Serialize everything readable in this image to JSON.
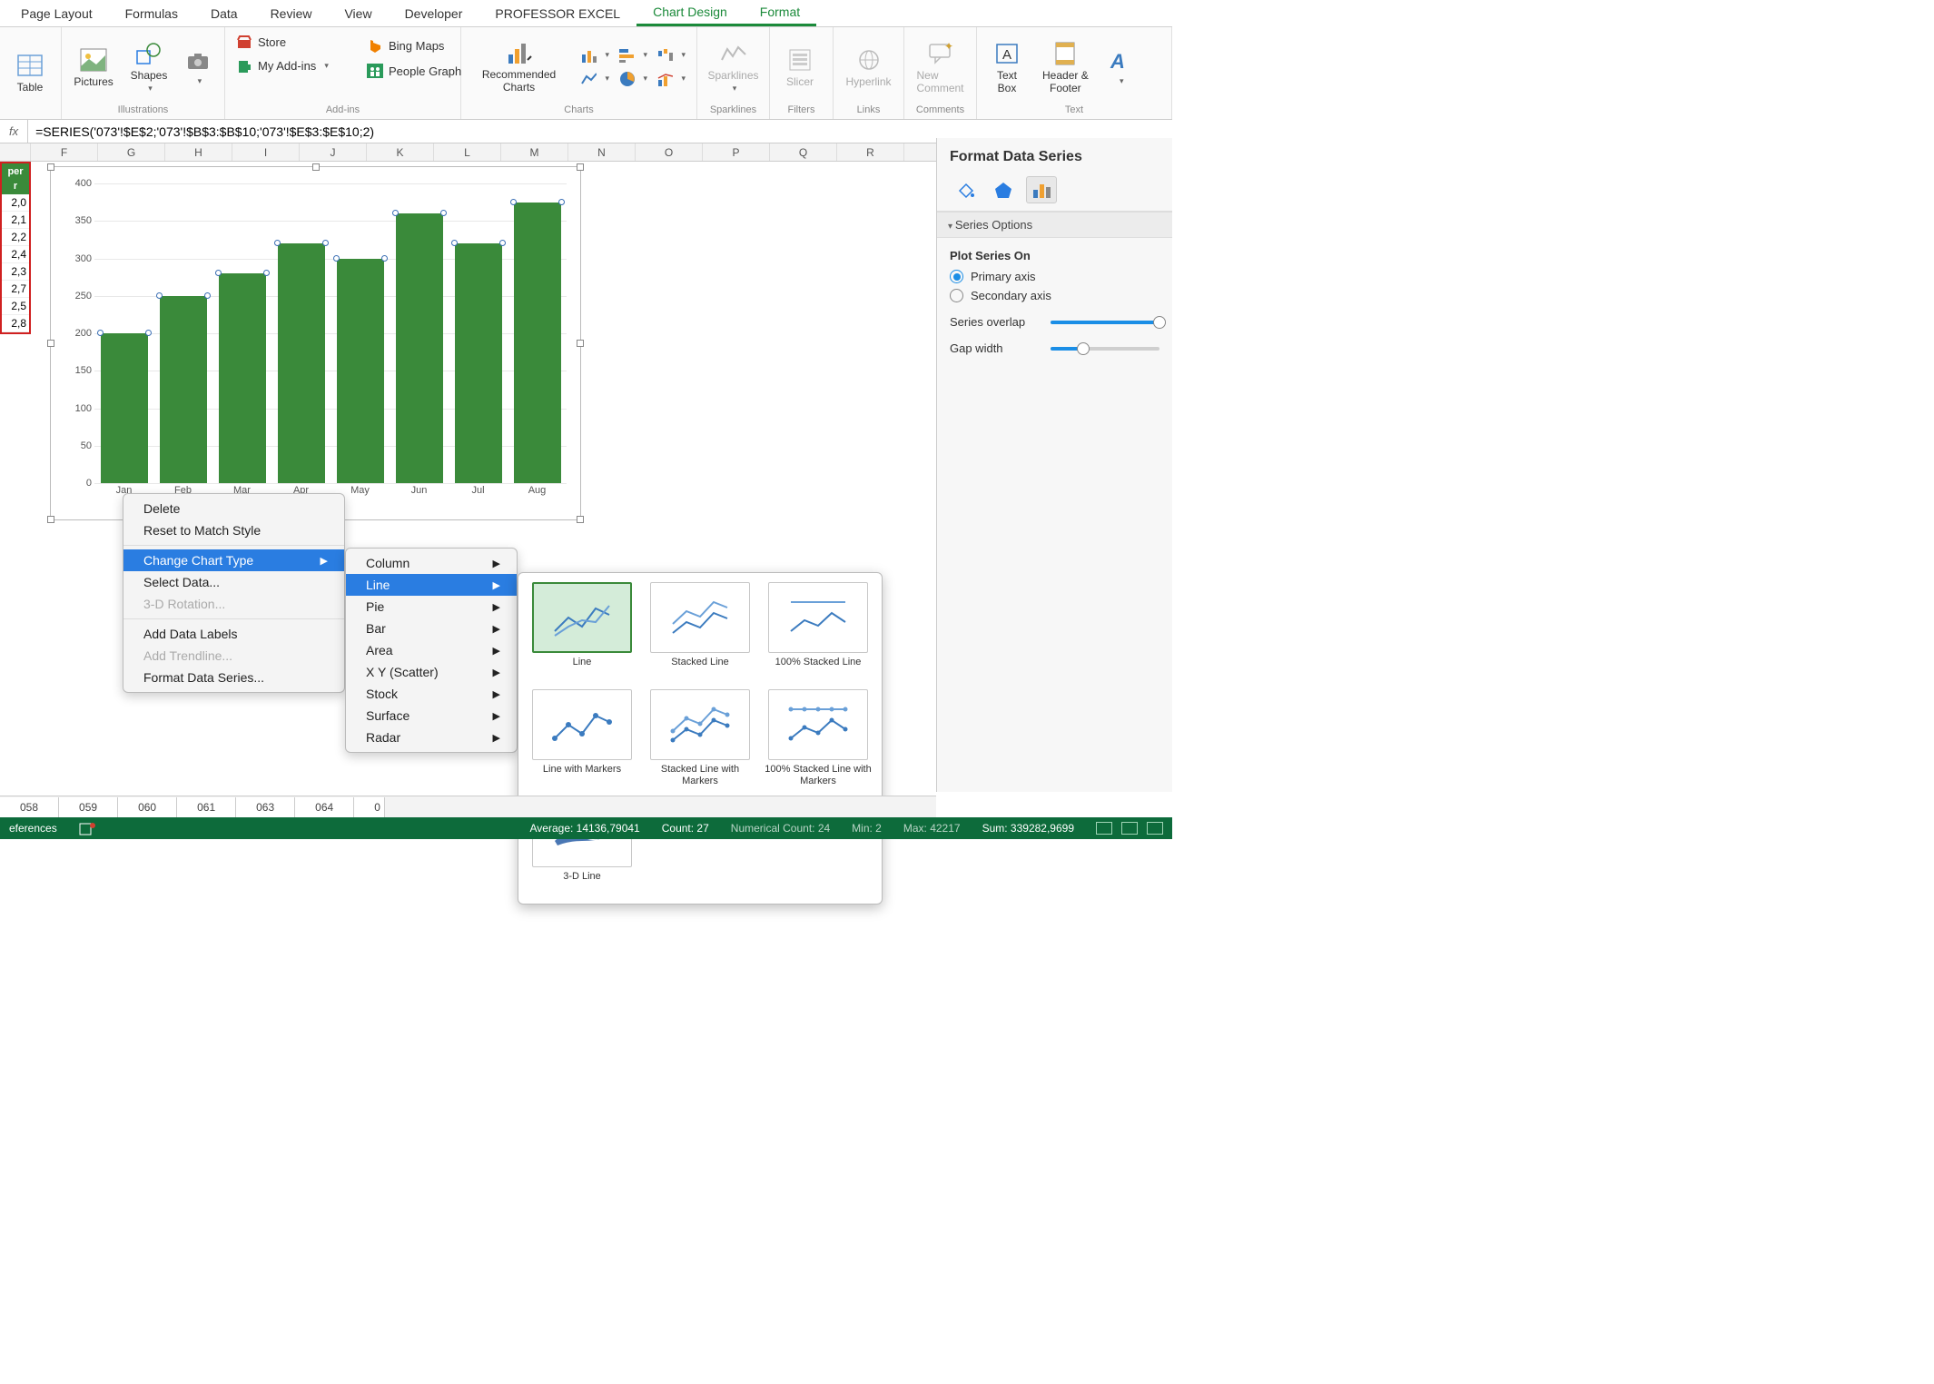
{
  "ribbon_tabs": [
    "Page Layout",
    "Formulas",
    "Data",
    "Review",
    "View",
    "Developer",
    "PROFESSOR EXCEL",
    "Chart Design",
    "Format"
  ],
  "ribbon_active_tabs": [
    "Chart Design",
    "Format"
  ],
  "ribbon": {
    "group1": {
      "table": "Table",
      "label": ""
    },
    "illustrations": {
      "pictures": "Pictures",
      "shapes": "Shapes",
      "label": "Illustrations"
    },
    "addins": {
      "store": "Store",
      "myaddins": "My Add-ins",
      "bingmaps": "Bing Maps",
      "peoplegraph": "People Graph",
      "label": "Add-ins"
    },
    "charts": {
      "recommended": "Recommended Charts",
      "label": "Charts"
    },
    "sparklines": {
      "btn": "Sparklines",
      "label": "Sparklines"
    },
    "filters": {
      "slicer": "Slicer",
      "label": "Filters"
    },
    "links": {
      "hyperlink": "Hyperlink",
      "label": "Links"
    },
    "comments": {
      "newcomment_l1": "New",
      "newcomment_l2": "Comment",
      "label": "Comments"
    },
    "text": {
      "textbox_l1": "Text",
      "textbox_l2": "Box",
      "hf_l1": "Header &",
      "hf_l2": "Footer",
      "label": "Text"
    }
  },
  "formula_bar": {
    "fx": "fx",
    "value": "=SERIES('073'!$E$2;'073'!$B$3:$B$10;'073'!$E$3:$E$10;2)"
  },
  "columns": [
    "F",
    "G",
    "H",
    "I",
    "J",
    "K",
    "L",
    "M",
    "N",
    "O",
    "P",
    "Q",
    "R"
  ],
  "data_col": {
    "hdr_l1": "per",
    "hdr_l2": "r",
    "values": [
      "2,0",
      "2,1",
      "2,2",
      "2,4",
      "2,3",
      "2,7",
      "2,5",
      "2,8"
    ]
  },
  "chart_data": {
    "type": "bar",
    "categories": [
      "Jan",
      "Feb",
      "Mar",
      "Apr",
      "May",
      "Jun",
      "Jul",
      "Aug"
    ],
    "values": [
      200,
      250,
      280,
      320,
      300,
      360,
      320,
      375
    ],
    "ylim": [
      0,
      400
    ],
    "yticks": [
      0,
      50,
      100,
      150,
      200,
      250,
      300,
      350,
      400
    ],
    "title": "",
    "xlabel": "",
    "ylabel": ""
  },
  "context_menu": {
    "items1": [
      "Delete",
      "Reset to Match Style"
    ],
    "items2": [
      {
        "label": "Change Chart Type",
        "sub": true,
        "hl": true
      },
      {
        "label": "Select Data...",
        "sub": false
      },
      {
        "label": "3-D Rotation...",
        "sub": false,
        "disabled": true
      }
    ],
    "items3": [
      {
        "label": "Add Data Labels"
      },
      {
        "label": "Add Trendline...",
        "disabled": true
      },
      {
        "label": "Format Data Series..."
      }
    ]
  },
  "chart_type_submenu": [
    "Column",
    "Line",
    "Pie",
    "Bar",
    "Area",
    "X Y (Scatter)",
    "Stock",
    "Surface",
    "Radar"
  ],
  "chart_type_highlight": "Line",
  "line_gallery": [
    "Line",
    "Stacked Line",
    "100% Stacked Line",
    "Line with Markers",
    "Stacked Line with Markers",
    "100% Stacked Line with Markers",
    "3-D Line"
  ],
  "line_gallery_selected": "Line",
  "right_panel": {
    "title": "Format Data Series",
    "section": "Series Options",
    "plot_on": "Plot Series On",
    "primary": "Primary axis",
    "secondary": "Secondary axis",
    "overlap": "Series overlap",
    "gap": "Gap width"
  },
  "sheet_tabs": [
    "058",
    "059",
    "060",
    "061",
    "063",
    "064"
  ],
  "sheet_tab_partial": "0",
  "status_bar": {
    "ref": "eferences",
    "avg": "Average: 14136,79041",
    "count": "Count: 27",
    "numcount": "Numerical Count: 24",
    "min": "Min: 2",
    "max": "Max: 42217",
    "sum": "Sum: 339282,9699"
  }
}
